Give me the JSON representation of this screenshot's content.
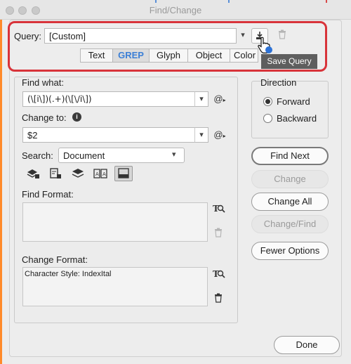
{
  "window": {
    "title": "Find/Change"
  },
  "query": {
    "label": "Query:",
    "value": "[Custom]"
  },
  "tabs": [
    {
      "label": "Text",
      "active": false
    },
    {
      "label": "GREP",
      "active": true
    },
    {
      "label": "Glyph",
      "active": false
    },
    {
      "label": "Object",
      "active": false
    },
    {
      "label": "Color",
      "active": false
    }
  ],
  "tooltip": "Save Query",
  "find_what": {
    "label": "Find what:",
    "value": "(\\[i\\])(.+)(\\[\\/i\\])"
  },
  "change_to": {
    "label": "Change to:",
    "value": "$2"
  },
  "search": {
    "label": "Search:",
    "value": "Document"
  },
  "find_format": {
    "label": "Find Format:",
    "value": ""
  },
  "change_format": {
    "label": "Change Format:",
    "value": "Character Style: IndexItal"
  },
  "direction": {
    "label": "Direction",
    "forward": "Forward",
    "backward": "Backward",
    "selected": "Forward"
  },
  "buttons": {
    "find_next": "Find Next",
    "change": "Change",
    "change_all": "Change All",
    "change_find": "Change/Find",
    "fewer_options": "Fewer Options",
    "done": "Done"
  },
  "icons": {
    "at_symbol": "@",
    "save_query": "save-query-icon",
    "delete_query": "trash-icon",
    "format_search": "format-search-icon",
    "trash": "trash-icon"
  },
  "colors": {
    "highlight": "#d8333a",
    "active_tab": "#3b7fd6",
    "tooltip_bg": "#5e5e5e"
  }
}
